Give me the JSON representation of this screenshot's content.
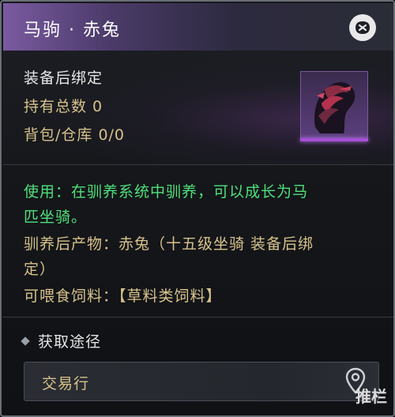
{
  "window": {
    "title": "马驹 · 赤兔"
  },
  "item_info": {
    "bind_status": "装备后绑定",
    "owned_total": "持有总数  0",
    "bag_storage": "背包/仓库  0/0"
  },
  "description": {
    "line1": "使用：在驯养系统中驯养，可以成长为马",
    "line2": "匹坐骑。",
    "line3": "驯养后产物：赤兔（十五级坐骑 装备后绑",
    "line4": "定）",
    "line5": "可喂食饲料：【草料类饲料】"
  },
  "acquisition": {
    "title": "获取途径",
    "sources": [
      "交易行"
    ]
  },
  "watermark": "推栏",
  "colors": {
    "gold": "#d8c28a",
    "green": "#4fe07a",
    "purple_accent": "#a64fd6"
  },
  "icons": {
    "close": "close-icon",
    "location": "map-pin-icon"
  }
}
